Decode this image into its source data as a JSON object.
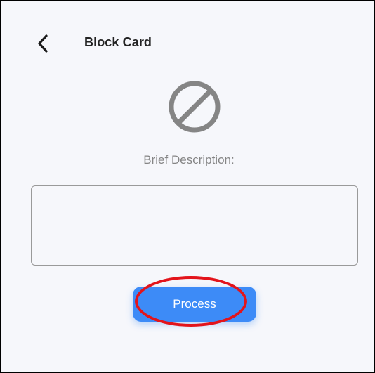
{
  "header": {
    "back_icon": "chevron-left-icon",
    "title": "Block Card"
  },
  "main": {
    "status_icon": "block-icon",
    "icon_color": "#858585",
    "description_label": "Brief Description:",
    "description_value": "",
    "process_label": "Process"
  },
  "colors": {
    "background": "#f6f7fb",
    "accent": "#3d8bf7",
    "highlight": "#e3141b"
  }
}
